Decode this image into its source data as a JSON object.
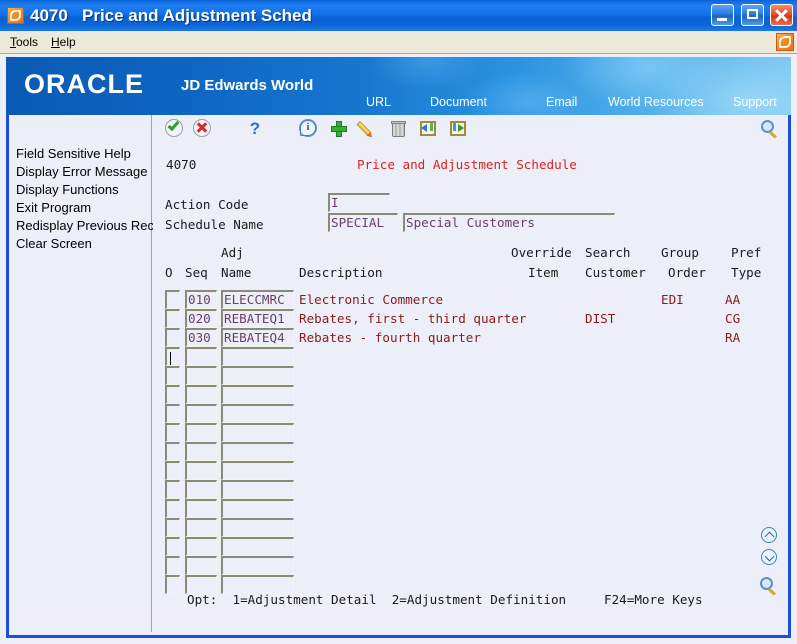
{
  "window": {
    "program_id": "4070",
    "title": "Price and Adjustment Sched",
    "minimize_label": "Minimize",
    "maximize_label": "Maximize",
    "close_label": "Close"
  },
  "menubar": {
    "items": [
      {
        "label": "Tools",
        "accel": "T"
      },
      {
        "label": "Help",
        "accel": "H"
      }
    ]
  },
  "banner": {
    "brand": "ORACLE",
    "product": "JD Edwards World",
    "nav": [
      {
        "label": "URL"
      },
      {
        "label": "Document"
      },
      {
        "label": "Email"
      },
      {
        "label": "World Resources"
      },
      {
        "label": "Support"
      }
    ]
  },
  "toolbar": {
    "icons": [
      {
        "name": "ok-icon",
        "label": "OK"
      },
      {
        "name": "cancel-icon",
        "label": "Cancel"
      },
      {
        "name": "help-question-icon",
        "label": "Help"
      },
      {
        "name": "info-icon",
        "label": "Information"
      },
      {
        "name": "add-icon",
        "label": "Add"
      },
      {
        "name": "edit-pencil-icon",
        "label": "Change"
      },
      {
        "name": "delete-trash-icon",
        "label": "Delete"
      },
      {
        "name": "exit-previous-icon",
        "label": "Previous"
      },
      {
        "name": "exit-next-icon",
        "label": "Exit"
      },
      {
        "name": "search-magnifier-icon",
        "label": "Search"
      }
    ]
  },
  "sidebar": {
    "items": [
      {
        "label": "Field Sensitive Help"
      },
      {
        "label": "Display Error Message"
      },
      {
        "label": "Display Functions"
      },
      {
        "label": "Exit Program"
      },
      {
        "label": "Redisplay Previous Rec"
      },
      {
        "label": "Clear Screen"
      }
    ]
  },
  "screen": {
    "program_number": "4070",
    "title": "Price and Adjustment Schedule"
  },
  "form": {
    "action_code_label": "Action Code",
    "action_code_value": "I",
    "schedule_name_label": "Schedule Name",
    "schedule_name_value": "SPECIAL",
    "schedule_description_value": "Special Customers"
  },
  "grid": {
    "headers_top": {
      "adj": "Adj",
      "override": "Override",
      "search": "Search",
      "group": "Group",
      "pref": "Pref"
    },
    "headers_bottom": {
      "o": "O",
      "seq": "Seq",
      "name": "Name",
      "description": "Description",
      "item": "Item",
      "customer": "Customer",
      "order": "Order",
      "type": "Type"
    },
    "rows": [
      {
        "o": "",
        "seq": "010",
        "adj_name": "ELECCMRC",
        "description": "Electronic Commerce",
        "override_item": "",
        "search_customer": "",
        "group_order": "EDI",
        "pref_type": "AA"
      },
      {
        "o": "",
        "seq": "020",
        "adj_name": "REBATEQ1",
        "description": "Rebates, first - third quarter",
        "override_item": "",
        "search_customer": "DIST",
        "group_order": "",
        "pref_type": "CG"
      },
      {
        "o": "",
        "seq": "030",
        "adj_name": "REBATEQ4",
        "description": "Rebates - fourth quarter",
        "override_item": "",
        "search_customer": "",
        "group_order": "",
        "pref_type": "RA"
      },
      {
        "o": "",
        "seq": "",
        "adj_name": "",
        "description": "",
        "override_item": "",
        "search_customer": "",
        "group_order": "",
        "pref_type": "",
        "cursor": true
      },
      {
        "o": "",
        "seq": "",
        "adj_name": "",
        "description": "",
        "override_item": "",
        "search_customer": "",
        "group_order": "",
        "pref_type": ""
      },
      {
        "o": "",
        "seq": "",
        "adj_name": "",
        "description": "",
        "override_item": "",
        "search_customer": "",
        "group_order": "",
        "pref_type": ""
      },
      {
        "o": "",
        "seq": "",
        "adj_name": "",
        "description": "",
        "override_item": "",
        "search_customer": "",
        "group_order": "",
        "pref_type": ""
      },
      {
        "o": "",
        "seq": "",
        "adj_name": "",
        "description": "",
        "override_item": "",
        "search_customer": "",
        "group_order": "",
        "pref_type": ""
      },
      {
        "o": "",
        "seq": "",
        "adj_name": "",
        "description": "",
        "override_item": "",
        "search_customer": "",
        "group_order": "",
        "pref_type": ""
      },
      {
        "o": "",
        "seq": "",
        "adj_name": "",
        "description": "",
        "override_item": "",
        "search_customer": "",
        "group_order": "",
        "pref_type": ""
      },
      {
        "o": "",
        "seq": "",
        "adj_name": "",
        "description": "",
        "override_item": "",
        "search_customer": "",
        "group_order": "",
        "pref_type": ""
      },
      {
        "o": "",
        "seq": "",
        "adj_name": "",
        "description": "",
        "override_item": "",
        "search_customer": "",
        "group_order": "",
        "pref_type": ""
      },
      {
        "o": "",
        "seq": "",
        "adj_name": "",
        "description": "",
        "override_item": "",
        "search_customer": "",
        "group_order": "",
        "pref_type": ""
      },
      {
        "o": "",
        "seq": "",
        "adj_name": "",
        "description": "",
        "override_item": "",
        "search_customer": "",
        "group_order": "",
        "pref_type": ""
      },
      {
        "o": "",
        "seq": "",
        "adj_name": "",
        "description": "",
        "override_item": "",
        "search_customer": "",
        "group_order": "",
        "pref_type": ""
      },
      {
        "o": "",
        "seq": "",
        "adj_name": "",
        "description": "",
        "override_item": "",
        "search_customer": "",
        "group_order": "",
        "pref_type": ""
      }
    ]
  },
  "footer": {
    "text": "Opt:  1=Adjustment Detail  2=Adjustment Definition     F24=More Keys"
  },
  "side_controls": {
    "page_up": "Page Up",
    "page_down": "Page Down",
    "search": "Search"
  },
  "colors": {
    "title_blue": "#1471e8",
    "frame_blue": "#1b4fd8",
    "screen_bg": "#eceff8",
    "red_title": "#e02020",
    "data_red": "#8b1a1a",
    "field_purple": "#6b3f6b"
  }
}
